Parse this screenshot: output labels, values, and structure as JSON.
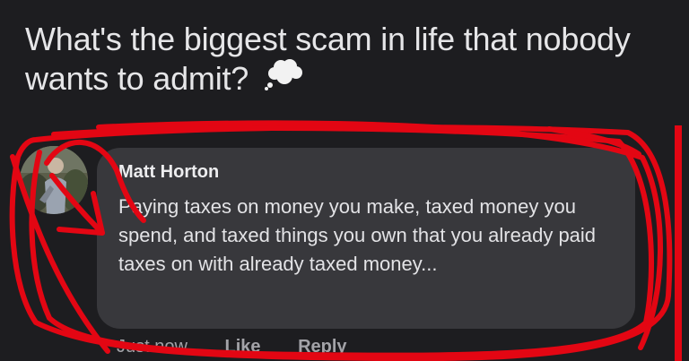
{
  "post": {
    "question": "What's the biggest scam in life that nobody wants to admit?",
    "question_icon": "thought-bubble-icon"
  },
  "comment": {
    "author": "Matt Horton",
    "text": "Paying taxes on money you make, taxed money you spend, and taxed things you own that you already paid taxes on with already taxed money...",
    "timestamp": "Just now",
    "like_label": "Like",
    "reply_label": "Reply",
    "avatar_icon": "profile-photo"
  },
  "annotation": {
    "color": "#e30613",
    "type": "hand-drawn circle and arrow"
  }
}
